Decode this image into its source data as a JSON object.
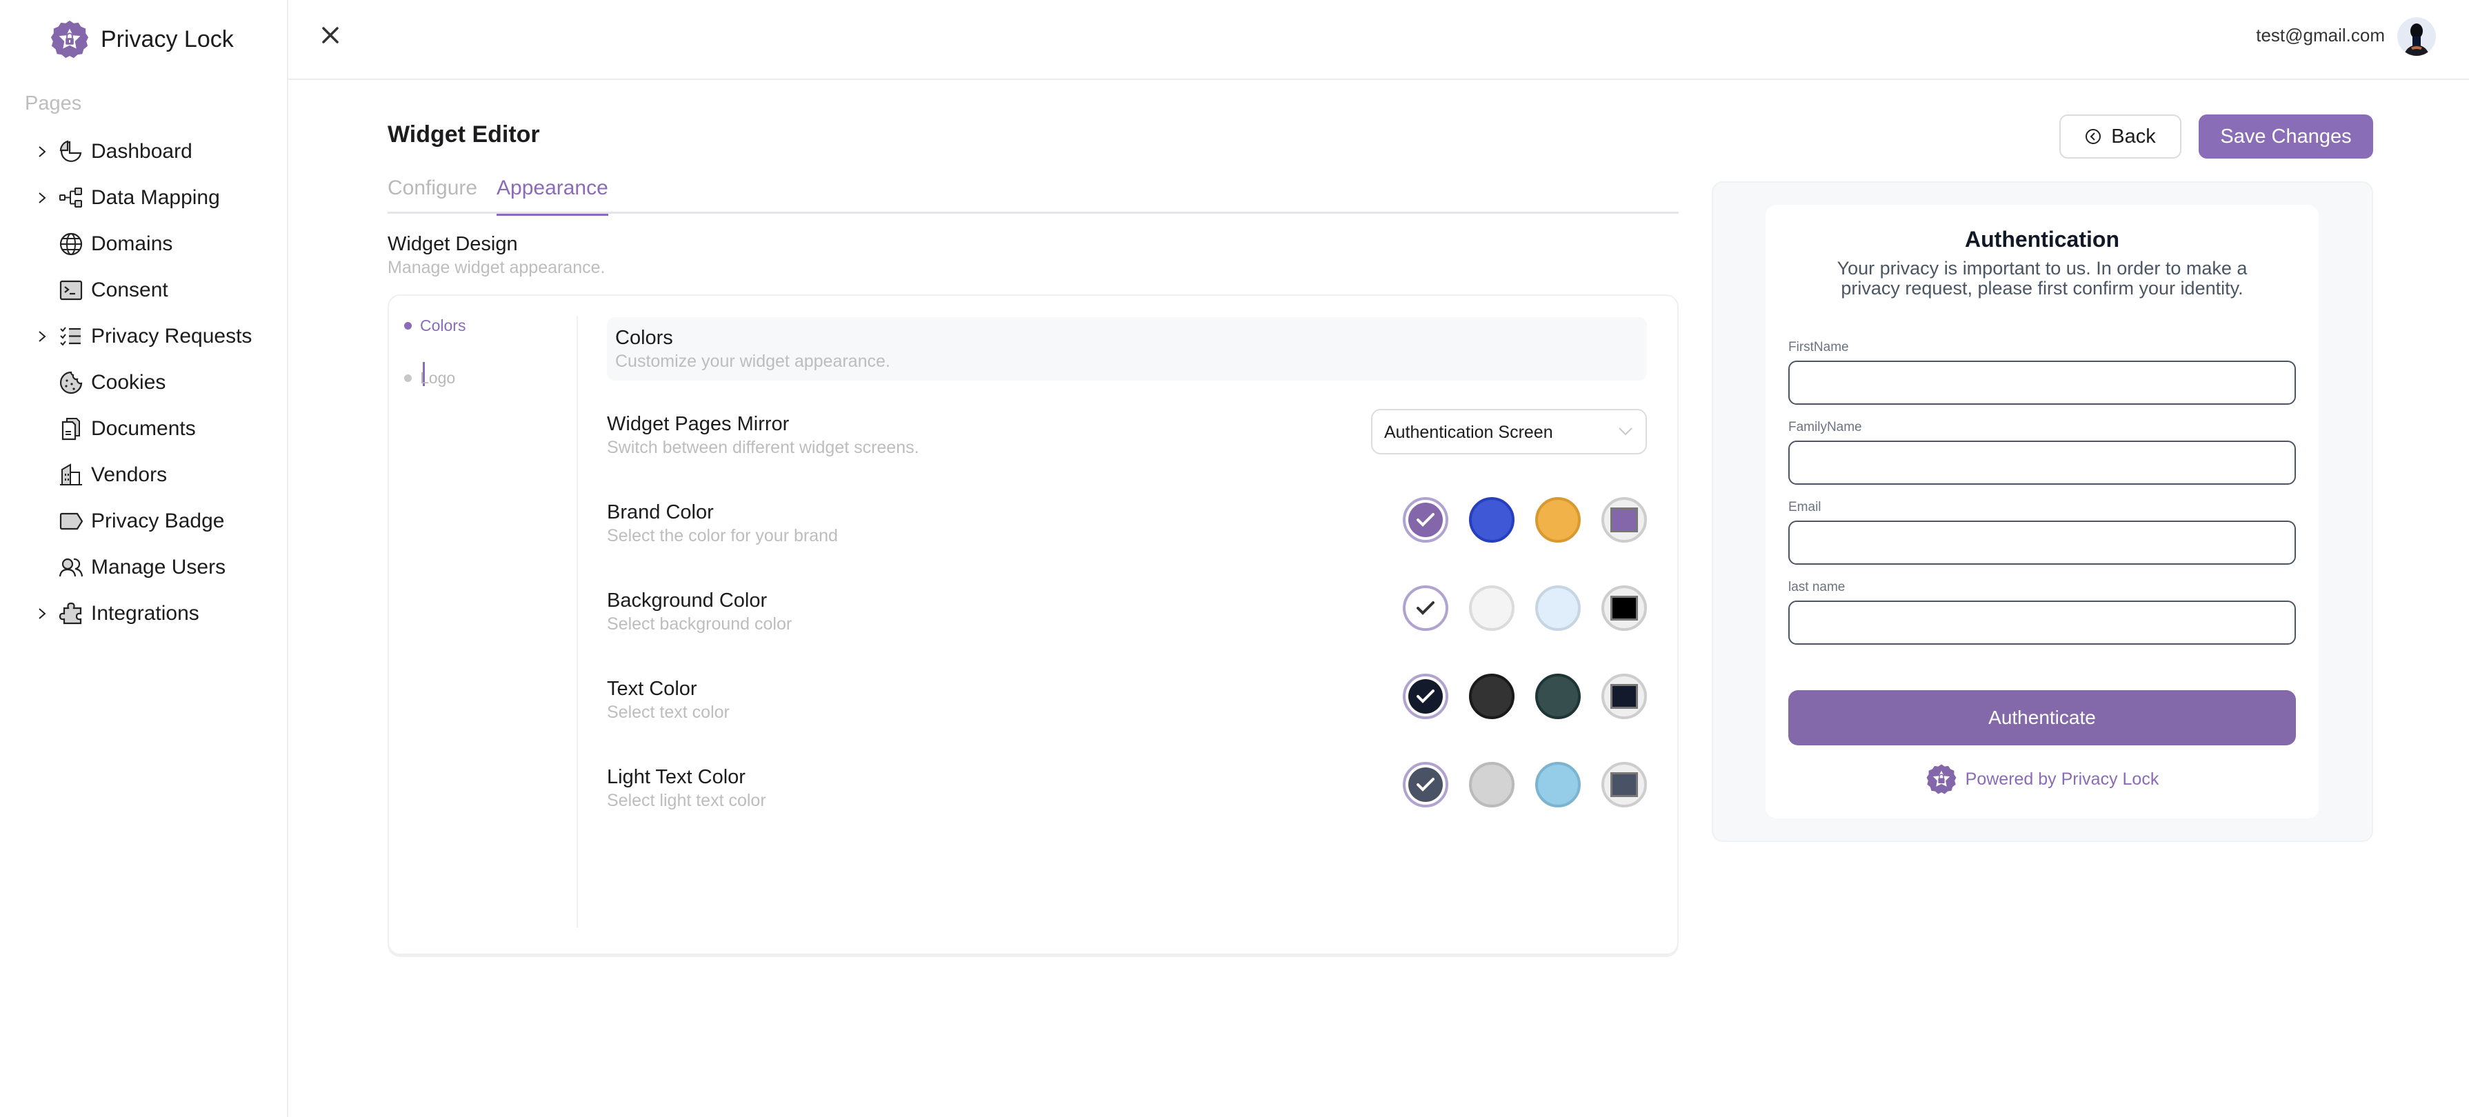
{
  "app": {
    "name": "Privacy Lock"
  },
  "sidebar": {
    "section_label": "Pages",
    "items": [
      {
        "label": "Dashboard",
        "icon": "pie-chart-icon",
        "expandable": true
      },
      {
        "label": "Data Mapping",
        "icon": "hierarchy-icon",
        "expandable": true
      },
      {
        "label": "Domains",
        "icon": "globe-icon",
        "expandable": false
      },
      {
        "label": "Consent",
        "icon": "terminal-icon",
        "expandable": false
      },
      {
        "label": "Privacy Requests",
        "icon": "checklist-icon",
        "expandable": true
      },
      {
        "label": "Cookies",
        "icon": "cookie-icon",
        "expandable": false
      },
      {
        "label": "Documents",
        "icon": "documents-icon",
        "expandable": false
      },
      {
        "label": "Vendors",
        "icon": "building-icon",
        "expandable": false
      },
      {
        "label": "Privacy Badge",
        "icon": "tag-icon",
        "expandable": false
      },
      {
        "label": "Manage Users",
        "icon": "users-icon",
        "expandable": false
      },
      {
        "label": "Integrations",
        "icon": "puzzle-icon",
        "expandable": true
      }
    ]
  },
  "header": {
    "user_email": "test@gmail.com"
  },
  "editor": {
    "title": "Widget Editor",
    "tabs": [
      {
        "label": "Configure",
        "active": false
      },
      {
        "label": "Appearance",
        "active": true
      }
    ],
    "back_label": "Back",
    "save_label": "Save Changes",
    "design": {
      "title": "Widget Design",
      "subtitle": "Manage widget appearance.",
      "steps": [
        {
          "label": "Colors",
          "active": true
        },
        {
          "label": "Logo",
          "active": false
        }
      ],
      "colors_header": {
        "title": "Colors",
        "subtitle": "Customize your widget appearance."
      },
      "pages_mirror": {
        "title": "Widget Pages Mirror",
        "subtitle": "Switch between different widget screens.",
        "selected": "Authentication Screen"
      },
      "color_settings": [
        {
          "title": "Brand Color",
          "subtitle": "Select the color for your brand",
          "options": [
            "#8466aa",
            "#3f59d6",
            "#f2b24a"
          ],
          "custom": "#8466aa",
          "selected_index": 0,
          "check_color": "#ffffff"
        },
        {
          "title": "Background Color",
          "subtitle": "Select background color",
          "options": [
            "#ffffff",
            "#f4f4f4",
            "#e0eefb"
          ],
          "custom": "#000000",
          "selected_index": 0,
          "check_color": "#333333"
        },
        {
          "title": "Text Color",
          "subtitle": "Select text color",
          "options": [
            "#121a2b",
            "#333333",
            "#374e4f"
          ],
          "custom": "#121a2b",
          "selected_index": 0,
          "check_color": "#ffffff"
        },
        {
          "title": "Light Text Color",
          "subtitle": "Select light text color",
          "options": [
            "#4a5366",
            "#d3d3d3",
            "#95cde8"
          ],
          "custom": "#4a5366",
          "selected_index": 0,
          "check_color": "#ffffff"
        }
      ]
    }
  },
  "preview": {
    "title": "Authentication",
    "description": "Your privacy is important to us. In order to make a privacy request, please first confirm your identity.",
    "fields": [
      {
        "label": "FirstName",
        "value": ""
      },
      {
        "label": "FamilyName",
        "value": ""
      },
      {
        "label": "Email",
        "value": ""
      },
      {
        "label": "last name",
        "value": ""
      }
    ],
    "button_label": "Authenticate",
    "powered_by": "Powered by Privacy Lock"
  },
  "colors": {
    "accent": "#8a6bb7",
    "button": "#8469aa"
  }
}
